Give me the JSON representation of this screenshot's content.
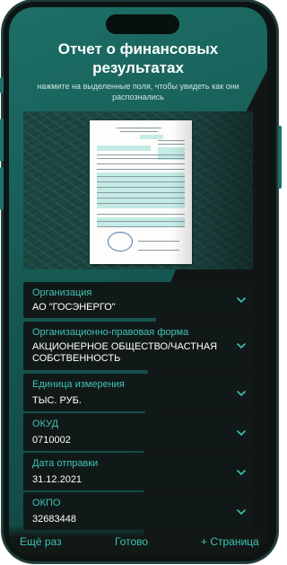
{
  "header": {
    "title": "Отчет о финансовых результатах",
    "subtitle": "нажмите на выделенные поля, чтобы увидеть как они распознались"
  },
  "fields": [
    {
      "label": "Организация",
      "value": "АО \"ГОСЭНЕРГО\""
    },
    {
      "label": "Организационно-правовая форма",
      "value": "АКЦИОНЕРНОЕ ОБЩЕСТВО/ЧАСТНАЯ СОБСТВЕННОСТЬ"
    },
    {
      "label": "Единица измерения",
      "value": "ТЫС. РУБ."
    },
    {
      "label": "ОКУД",
      "value": "0710002"
    },
    {
      "label": "Дата отправки",
      "value": "31.12.2021"
    },
    {
      "label": "ОКПО",
      "value": "32683448"
    }
  ],
  "footer": {
    "retry_label": "Ещё раз",
    "done_label": "Готово",
    "add_page_label": "+ Страница"
  },
  "icons": {
    "field_status": "check-icon"
  },
  "colors": {
    "accent": "#3fc3b4",
    "background": "#111514",
    "teal_panel": "#1c6f67"
  }
}
